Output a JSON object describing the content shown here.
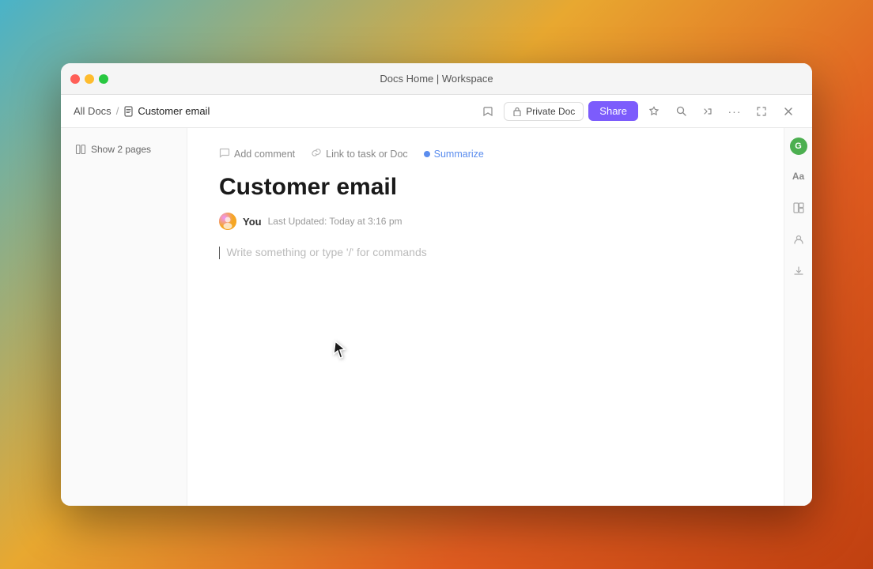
{
  "window": {
    "title": "Docs Home | Workspace",
    "traffic_lights": [
      "red",
      "yellow",
      "green"
    ]
  },
  "toolbar": {
    "breadcrumb": {
      "parent": "All Docs",
      "separator": "/",
      "current": "Customer email"
    },
    "private_doc_label": "Private Doc",
    "share_label": "Share",
    "icons": {
      "lock": "🔒",
      "star": "☆",
      "search": "⌕",
      "export": "↗",
      "more": "···",
      "minimize": "⤡",
      "close": "×"
    }
  },
  "sidebar": {
    "show_pages_label": "Show 2 pages"
  },
  "doc": {
    "add_comment_label": "Add comment",
    "link_task_label": "Link to task or Doc",
    "summarize_label": "Summarize",
    "title": "Customer email",
    "author": "You",
    "last_updated": "Last Updated: Today at 3:16 pm",
    "editor_placeholder": "Write something or type '/' for commands"
  },
  "right_sidebar": {
    "format_icon": "Aa",
    "layout_icon": "⊞",
    "users_icon": "👤",
    "download_icon": "↓",
    "ai_label": "G"
  }
}
